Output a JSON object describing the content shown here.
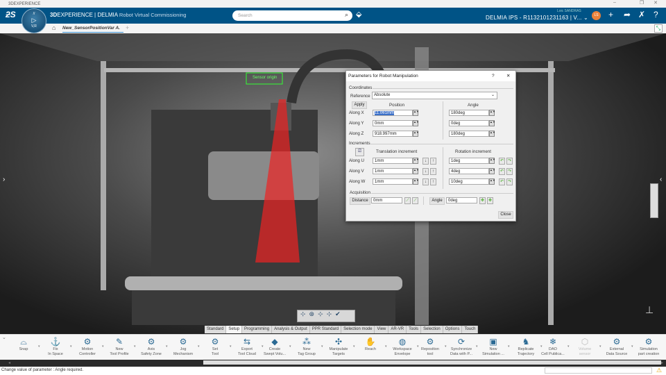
{
  "window": {
    "title": "3DEXPERIENCE",
    "minimize": "–",
    "restore": "❐",
    "close": "✕"
  },
  "topbar": {
    "brand_bold": "3D",
    "brand_rest": "EXPERIENCE | DELMIA",
    "app": "Robot Virtual Commissioning",
    "compass": {
      "top": "//",
      "left": "3D",
      "right": "i",
      "bottom": "V,R"
    },
    "search_placeholder": "Search",
    "user": "Loic SANDRAS",
    "platform": "DELMIA IPS - R1132101231163 | V...",
    "avatar_initials": "LS",
    "brand_color": "#005386"
  },
  "tabs": {
    "document": "New_SensorPositionVar A.",
    "add": "+"
  },
  "viewport": {
    "sensor_label": "Sensor origin"
  },
  "dialog": {
    "title": "Parameters for Robot Manipulation",
    "help": "?",
    "close_x": "✕",
    "coordinates": "Coordinates",
    "reference_label": "Reference",
    "reference_value": "Absolute",
    "apply": "Apply",
    "position_header": "Position",
    "angle_header": "Angle",
    "rows": [
      {
        "label": "Along X",
        "position": "11.061mm",
        "angle": "180deg"
      },
      {
        "label": "Along Y",
        "position": "0mm",
        "angle": "0deg"
      },
      {
        "label": "Along Z",
        "position": "918.997mm",
        "angle": "180deg"
      }
    ],
    "increments": "Increments",
    "translation_header": "Translation increment",
    "rotation_header": "Rotation increment",
    "inc_rows": [
      {
        "label": "Along U",
        "translation": "1mm",
        "rotation": "1deg"
      },
      {
        "label": "Along V",
        "translation": "1mm",
        "rotation": "4deg"
      },
      {
        "label": "Along W",
        "translation": "1mm",
        "rotation": "10deg"
      }
    ],
    "acquisition": "Acquisition",
    "distance_btn": "Distance",
    "distance_value": "0mm",
    "angle_btn": "Angle",
    "angle_value": "0deg",
    "close_btn": "Close"
  },
  "toolbar_tabs": [
    {
      "label": "Standard",
      "active": false
    },
    {
      "label": "Setup",
      "active": true
    },
    {
      "label": "Programming"
    },
    {
      "label": "Analysis & Output"
    },
    {
      "label": "PPR Standard"
    },
    {
      "label": "Selection mode"
    },
    {
      "label": "View"
    },
    {
      "label": "AR-VR"
    },
    {
      "label": "Tools"
    },
    {
      "label": "Selection"
    },
    {
      "label": "Options"
    },
    {
      "label": "Touch"
    }
  ],
  "tools": [
    {
      "l1": "Snap",
      "l2": "",
      "icon": "snap-icon",
      "g": "⌓"
    },
    {
      "l1": "Fix",
      "l2": "In Space",
      "icon": "anchor-icon",
      "g": "⚓"
    },
    {
      "l1": "Motion",
      "l2": "Controller",
      "icon": "motion-controller-icon",
      "g": "⚙"
    },
    {
      "l1": "New",
      "l2": "Tool Profile",
      "icon": "tool-profile-icon",
      "g": "✎"
    },
    {
      "l1": "Axis",
      "l2": "Safety Zone",
      "icon": "safety-zone-icon",
      "g": "⚙"
    },
    {
      "l1": "Jog",
      "l2": "Mechanism",
      "icon": "jog-icon",
      "g": "⚙"
    },
    {
      "l1": "Set",
      "l2": "Tool",
      "icon": "set-tool-icon",
      "g": "⚙"
    },
    {
      "l1": "Export",
      "l2": "Tool Cloud",
      "icon": "export-icon",
      "g": "⇆"
    },
    {
      "l1": "Create",
      "l2": "Swept Volu...",
      "icon": "swept-volume-icon",
      "g": "◆"
    },
    {
      "l1": "New",
      "l2": "Tag Group",
      "icon": "tag-group-icon",
      "g": "⁂"
    },
    {
      "l1": "Manipulate",
      "l2": "Targets",
      "icon": "targets-icon",
      "g": "✣"
    },
    {
      "l1": "Reach",
      "l2": "",
      "icon": "reach-icon",
      "g": "✋"
    },
    {
      "l1": "Workspace",
      "l2": "Envelope",
      "icon": "envelope-icon",
      "g": "◍"
    },
    {
      "l1": "Reposition",
      "l2": "tool",
      "icon": "reposition-icon",
      "g": "⚙"
    },
    {
      "l1": "Synchronize",
      "l2": "Data with P...",
      "icon": "sync-icon",
      "g": "⟳"
    },
    {
      "l1": "New",
      "l2": "Simulation ...",
      "icon": "simulation-icon",
      "g": "▣"
    },
    {
      "l1": "Replicate",
      "l2": "Trajectory",
      "icon": "trajectory-icon",
      "g": "♞"
    },
    {
      "l1": "DAO",
      "l2": "Cell Publica...",
      "icon": "dao-icon",
      "g": "❄"
    },
    {
      "l1": "Volume",
      "l2": "sensor",
      "icon": "volume-sensor-icon",
      "g": "⬡",
      "disabled": true
    },
    {
      "l1": "External",
      "l2": "Data Source",
      "icon": "external-data-icon",
      "g": "⚙"
    },
    {
      "l1": "Simulation",
      "l2": "part creation",
      "icon": "part-creation-icon",
      "g": "⚙"
    }
  ],
  "status": {
    "message": "Change value of parameter : Angle required."
  }
}
